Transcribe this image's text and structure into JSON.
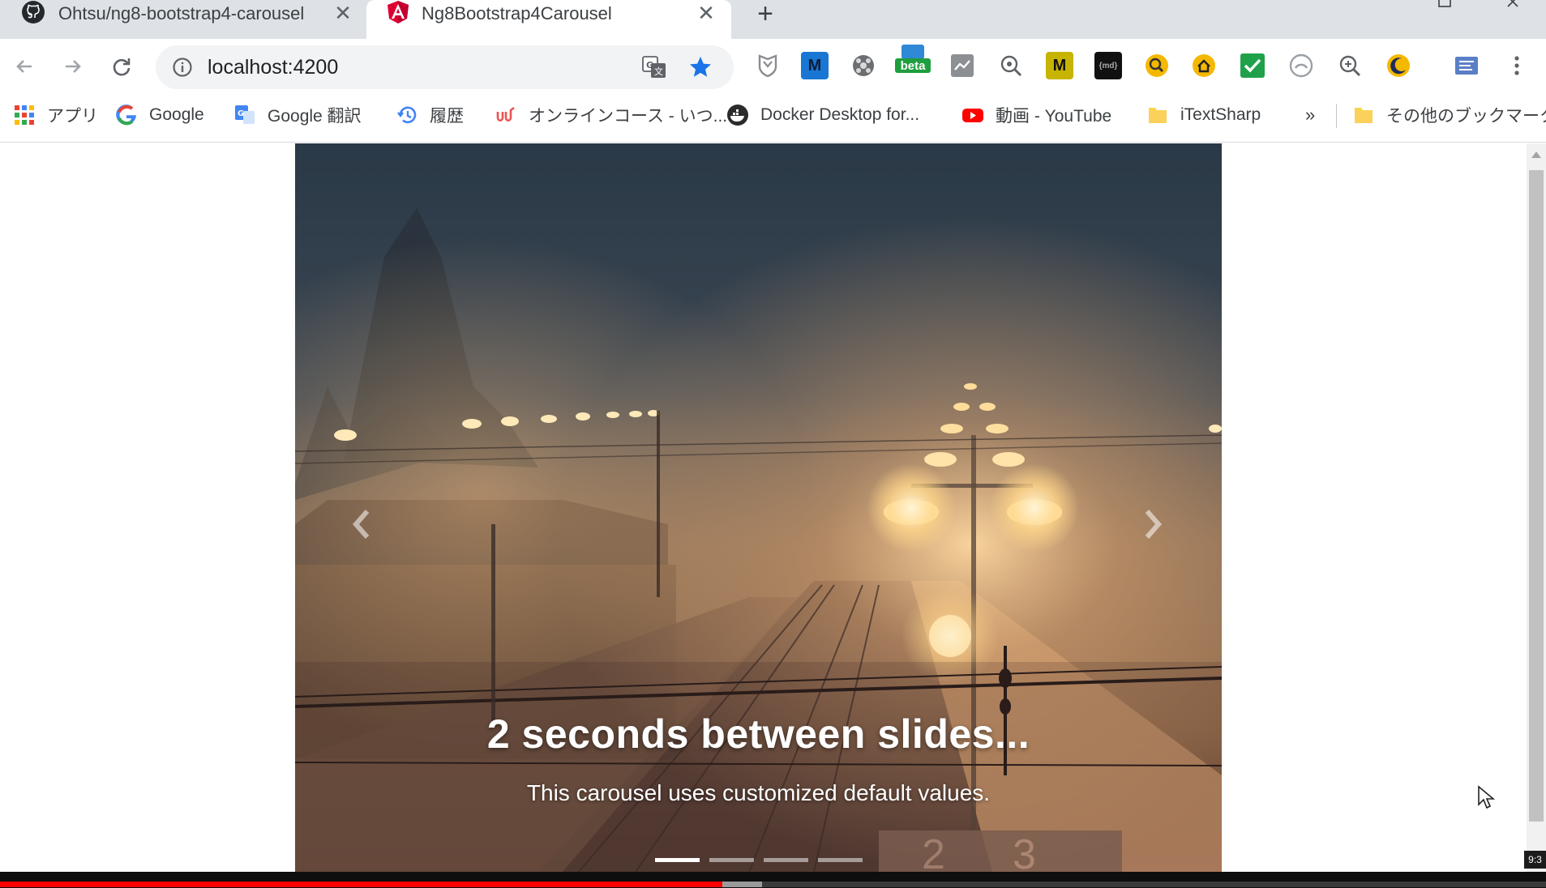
{
  "browser": {
    "tabs": [
      {
        "title": "Ohtsu/ng8-bootstrap4-carousel",
        "icon": "github-icon",
        "active": false
      },
      {
        "title": "Ng8Bootstrap4Carousel",
        "icon": "angular-icon",
        "active": true
      }
    ],
    "close_glyph": "✕",
    "new_tab_glyph": "+",
    "url": "localhost:4200",
    "extensions": [
      "shield-extension",
      "m-extension",
      "film-extension",
      "beta-extension",
      "chart-extension",
      "search-extension",
      "m-yellow-extension",
      "md-extension",
      "search-yellow-extension",
      "home-extension",
      "check-extension",
      "circle-extension",
      "zoom-extension",
      "moon-extension",
      "map-extension"
    ],
    "beta_label": "beta",
    "md_label": "{md}",
    "m_label": "M"
  },
  "bookmarks": {
    "items": [
      {
        "label": "アプリ",
        "icon": "apps-grid-icon"
      },
      {
        "label": "Google",
        "icon": "google-icon"
      },
      {
        "label": "Google 翻訳",
        "icon": "google-translate-icon"
      },
      {
        "label": "履歴",
        "icon": "history-icon"
      },
      {
        "label": "オンラインコース - いつ...",
        "icon": "udemy-icon"
      },
      {
        "label": "Docker Desktop for...",
        "icon": "docker-icon"
      },
      {
        "label": "動画 - YouTube",
        "icon": "youtube-icon"
      },
      {
        "label": "iTextSharp",
        "icon": "folder-icon"
      }
    ],
    "overflow_glyph": "»",
    "other_label": "その他のブックマーク"
  },
  "carousel": {
    "caption_title": "2 seconds between slides...",
    "caption_text": "This carousel uses customized default values.",
    "slide_count": 4,
    "active_slide": 0,
    "platform_signs": [
      "2",
      "3"
    ]
  },
  "player": {
    "time_label": "9:3",
    "played_fraction": 0.467,
    "buffered_fraction": 0.493
  },
  "colors": {
    "accent_blue": "#1a73e8",
    "tab_strip": "#dee1e6",
    "progress_red": "#ff0000"
  }
}
